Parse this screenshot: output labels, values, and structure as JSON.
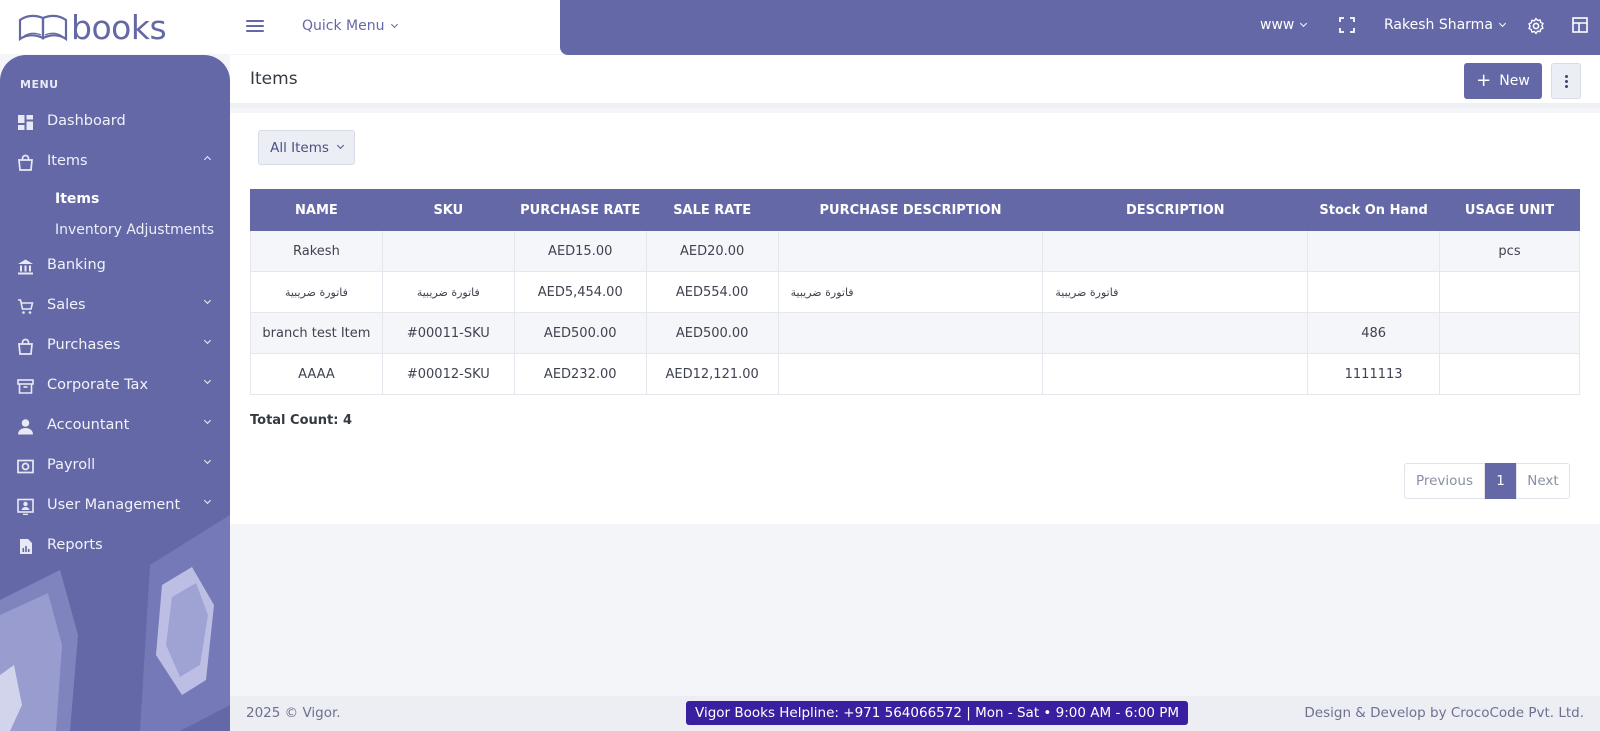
{
  "brand": {
    "name": "books",
    "accent": "#6468a6"
  },
  "topbar": {
    "quick_menu_label": "Quick Menu",
    "workspace_label": "www",
    "user_name": "Rakesh Sharma"
  },
  "sidebar": {
    "menu_title": "MENU",
    "items": [
      {
        "label": "Dashboard",
        "icon": "dashboard-icon"
      },
      {
        "label": "Items",
        "icon": "shopping-bag-icon",
        "expanded": true
      },
      {
        "label": "Banking",
        "icon": "bank-icon"
      },
      {
        "label": "Sales",
        "icon": "cart-icon"
      },
      {
        "label": "Purchases",
        "icon": "shopping-bag-icon"
      },
      {
        "label": "Corporate Tax",
        "icon": "archive-icon"
      },
      {
        "label": "Accountant",
        "icon": "user-icon"
      },
      {
        "label": "Payroll",
        "icon": "money-icon"
      },
      {
        "label": "User Management",
        "icon": "user-badge-icon"
      },
      {
        "label": "Reports",
        "icon": "report-icon"
      }
    ],
    "sub_items": [
      {
        "label": "Items",
        "active": true
      },
      {
        "label": "Inventory Adjustments",
        "active": false
      }
    ]
  },
  "page": {
    "title": "Items",
    "new_button_label": "New",
    "filter_label": "All Items",
    "total_count_label": "Total Count: 4"
  },
  "table": {
    "columns": [
      "NAME",
      "SKU",
      "PURCHASE RATE",
      "SALE RATE",
      "PURCHASE DESCRIPTION",
      "DESCRIPTION",
      "Stock On Hand",
      "USAGE UNIT"
    ],
    "rows": [
      [
        "Rakesh",
        "",
        "AED15.00",
        "AED20.00",
        "",
        "",
        "",
        "pcs"
      ],
      [
        "فاتورة ضريبية",
        "فاتورة ضريبية",
        "AED5,454.00",
        "AED554.00",
        "فاتورة ضريبية",
        "فاتورة ضريبية",
        "",
        ""
      ],
      [
        "branch test Item",
        "#00011-SKU",
        "AED500.00",
        "AED500.00",
        "",
        "",
        "486",
        ""
      ],
      [
        "AAAA",
        "#00012-SKU",
        "AED232.00",
        "AED12,121.00",
        "",
        "",
        "1111113",
        ""
      ]
    ]
  },
  "pagination": {
    "previous": "Previous",
    "current": "1",
    "next": "Next"
  },
  "footer": {
    "copyright": "2025 © Vigor.",
    "helpline": "Vigor Books Helpline: +971 564066572 | Mon - Sat • 9:00 AM - 6:00 PM",
    "credit": "Design & Develop by CrocoCode Pvt. Ltd."
  }
}
